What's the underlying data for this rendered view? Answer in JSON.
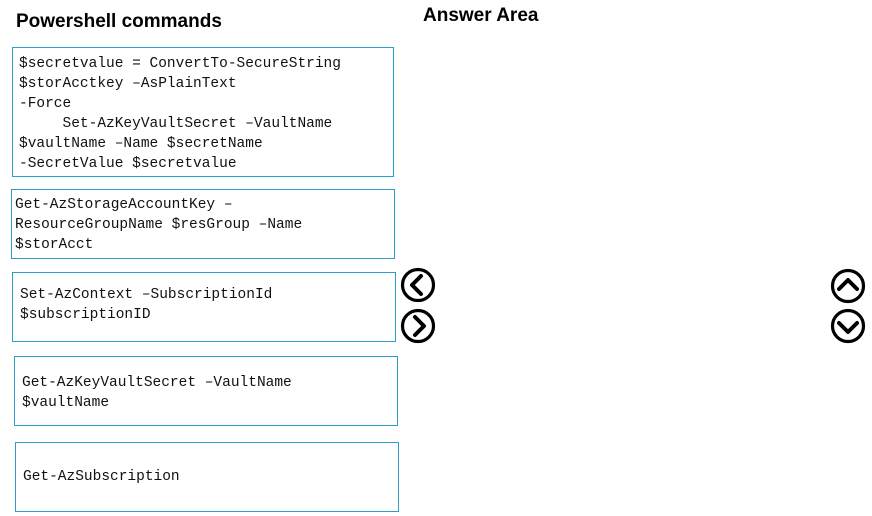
{
  "headings": {
    "commands": "Powershell commands",
    "answer_area": "Answer Area"
  },
  "commands": [
    "$secretvalue = ConvertTo-SecureString\n$storAcctkey –AsPlainText\n-Force\n     Set-AzKeyVaultSecret –VaultName\n$vaultName –Name $secretName\n-SecretValue $secretvalue",
    "Get-AzStorageAccountKey –\nResourceGroupName $resGroup –Name\n$storAcct",
    "Set-AzContext –SubscriptionId\n$subscriptionID",
    "Get-AzKeyVaultSecret –VaultName\n$vaultName",
    "Get-AzSubscription"
  ],
  "controls": {
    "move_left": "chevron-left-icon",
    "move_right": "chevron-right-icon",
    "move_up": "chevron-up-icon",
    "move_down": "chevron-down-icon"
  },
  "colors": {
    "box_border": "#2b9fc7",
    "text": "#000000"
  }
}
